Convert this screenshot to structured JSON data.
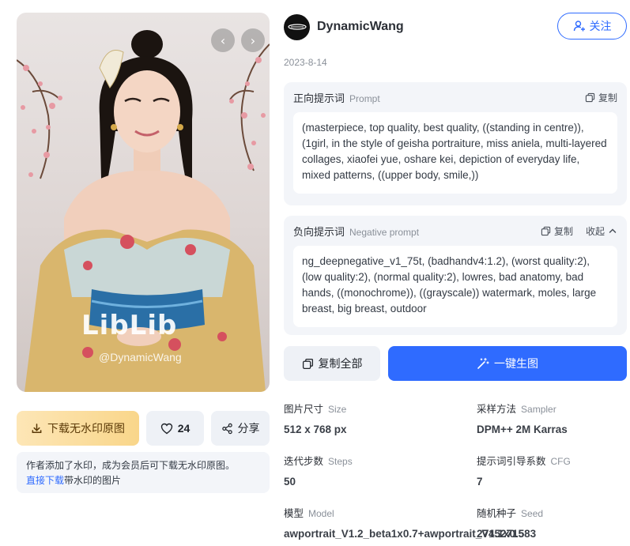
{
  "image": {
    "watermark_brand": "LibLib",
    "watermark_user": "@DynamicWang",
    "prev_icon": "chevron-left-icon",
    "next_icon": "chevron-right-icon"
  },
  "actions": {
    "download_label": "下载无水印原图",
    "like_count": "24",
    "share_label": "分享"
  },
  "notice": {
    "text": "作者添加了水印，成为会员后可下载无水印原图。",
    "link_label": "直接下载",
    "link_suffix": "带水印的图片"
  },
  "author": {
    "name": "DynamicWang",
    "follow_label": "关注",
    "date": "2023-8-14"
  },
  "positive_prompt": {
    "title": "正向提示词",
    "subtitle": "Prompt",
    "copy_label": "复制",
    "text": "(masterpiece, top quality, best quality, ((standing in centre)), (1girl, in the style of geisha portraiture, miss aniela, multi-layered collages, xiaofei yue, oshare kei, depiction of everyday life, mixed patterns, ((upper body, smile,))"
  },
  "negative_prompt": {
    "title": "负向提示词",
    "subtitle": "Negative prompt",
    "copy_label": "复制",
    "collapse_label": "收起",
    "text": "ng_deepnegative_v1_75t, (badhandv4:1.2), (worst quality:2), (low quality:2), (normal quality:2), lowres, bad anatomy, bad hands, ((monochrome)), ((grayscale)) watermark, moles, large breast, big breast, outdoor"
  },
  "buttons": {
    "copy_all_label": "复制全部",
    "generate_label": "一键生图"
  },
  "params": {
    "size_label": "图片尺寸",
    "size_sub": "Size",
    "size_value": "512 x 768 px",
    "sampler_label": "采样方法",
    "sampler_sub": "Sampler",
    "sampler_value": "DPM++ 2M Karras",
    "steps_label": "迭代步数",
    "steps_sub": "Steps",
    "steps_value": "50",
    "cfg_label": "提示词引导系数",
    "cfg_sub": "CFG",
    "cfg_value": "7",
    "model_label": "模型",
    "model_sub": "Model",
    "model_value": "awportrait_V1.2_beta1x0.7+awportrait_V1.1x0.5",
    "seed_label": "随机种子",
    "seed_sub": "Seed",
    "seed_value": "2745271583"
  },
  "colors": {
    "accent": "#2f6bff",
    "download_gold": "#f9d68a",
    "panel_bg": "#f3f5f9"
  }
}
